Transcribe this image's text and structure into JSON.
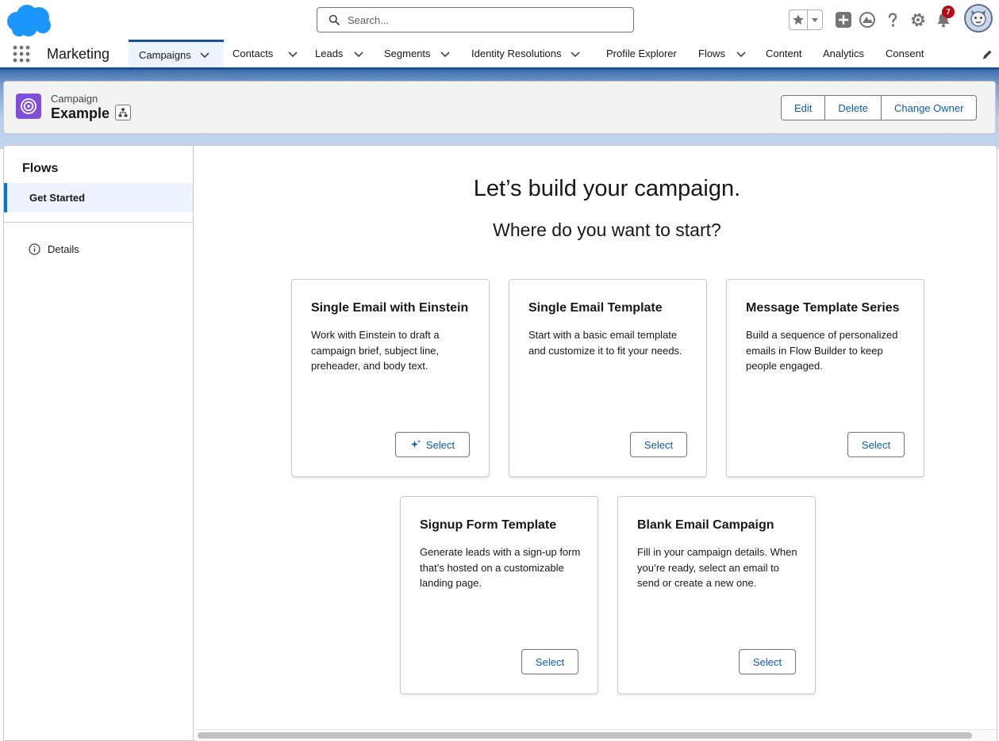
{
  "header": {
    "search_placeholder": "Search...",
    "notification_count": "7",
    "icons": [
      "salesforce-cloud-logo",
      "search-icon",
      "favorites-star-icon",
      "chevron-down-icon",
      "global-add-icon",
      "trailhead-icon",
      "help-icon",
      "setup-gear-icon",
      "bell-icon",
      "avatar"
    ]
  },
  "nav": {
    "app_name": "Marketing",
    "items": [
      {
        "label": "Campaigns",
        "has_menu": true,
        "active": true
      },
      {
        "label": "Contacts",
        "has_menu": true
      },
      {
        "label": "Leads",
        "has_menu": true
      },
      {
        "label": "Segments",
        "has_menu": true
      },
      {
        "label": "Identity Resolutions",
        "has_menu": true
      },
      {
        "label": "Profile Explorer",
        "has_menu": false
      },
      {
        "label": "Flows",
        "has_menu": true
      },
      {
        "label": "Content",
        "has_menu": false
      },
      {
        "label": "Analytics",
        "has_menu": false
      },
      {
        "label": "Consent",
        "has_menu": false
      }
    ]
  },
  "record": {
    "type": "Campaign",
    "name": "Example",
    "actions": [
      "Edit",
      "Delete",
      "Change Owner"
    ]
  },
  "sidebar": {
    "title": "Flows",
    "active_item": "Get Started",
    "details_label": "Details"
  },
  "main": {
    "heading": "Let’s build your campaign.",
    "subheading": "Where do you want to start?",
    "cards": [
      {
        "title": "Single Email with Einstein",
        "description": "Work with Einstein to draft a campaign brief, subject line, preheader, and body text.",
        "button": "Select",
        "einstein_icon": true
      },
      {
        "title": "Single Email Template",
        "description": "Start with a basic email template and customize it to fit your needs.",
        "button": "Select"
      },
      {
        "title": "Message Template Series",
        "description": "Build a sequence of personalized emails in Flow Builder to keep people engaged.",
        "button": "Select"
      },
      {
        "title": "Signup Form Template",
        "description": "Generate leads with a sign-up form that’s hosted on a customizable landing page.",
        "button": "Select"
      },
      {
        "title": "Blank Email Campaign",
        "description": "Fill in your campaign details. When you’re ready, select an email to send or create a new one.",
        "button": "Select"
      }
    ]
  },
  "colors": {
    "brand_blue": "#1b5297",
    "link_blue": "#0b5cab",
    "campaign_icon": "#7f4fdc",
    "badge_red": "#ba0517",
    "active_tab_bg": "#eef4ff"
  }
}
